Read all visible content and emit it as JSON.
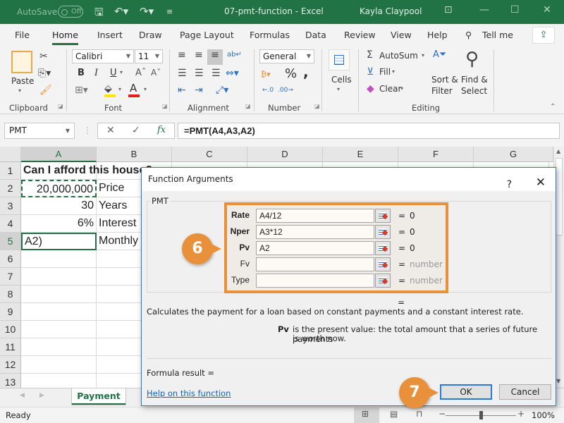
{
  "titlebar": {
    "autosave_label": "AutoSave",
    "autosave_state": "Off",
    "title": "07-pmt-function  -  Excel",
    "user": "Kayla Claypool"
  },
  "menu_tabs": [
    "File",
    "Home",
    "Insert",
    "Draw",
    "Page Layout",
    "Formulas",
    "Data",
    "Review",
    "View",
    "Help",
    "Tell me"
  ],
  "ribbon": {
    "clipboard": {
      "paste": "Paste",
      "label": "Clipboard"
    },
    "font": {
      "name": "Calibri",
      "size": "11",
      "label": "Font",
      "bold": "B",
      "italic": "I",
      "underline": "U",
      "fill_color": "#ffe600",
      "font_color": "#e0201b"
    },
    "alignment": {
      "label": "Alignment"
    },
    "number": {
      "format": "General",
      "label": "Number",
      "percent": "%",
      "comma": ","
    },
    "cells": {
      "label": "Cells"
    },
    "editing": {
      "autosum": "AutoSum",
      "fill": "Fill",
      "clear": "Clear",
      "sort_filter_1": "Sort &",
      "sort_filter_2": "Filter",
      "find_select_1": "Find &",
      "find_select_2": "Select",
      "label": "Editing"
    }
  },
  "formula_bar": {
    "name_box": "PMT",
    "formula": "=PMT(A4,A3,A2)"
  },
  "grid": {
    "columns": [
      "A",
      "B",
      "C",
      "D",
      "E",
      "F",
      "G"
    ],
    "rows": [
      "1",
      "2",
      "3",
      "4",
      "5",
      "6",
      "7",
      "8",
      "9",
      "10",
      "11",
      "12",
      "13"
    ],
    "cells": {
      "A1": "Can I afford this house?",
      "A2": "20,000,000",
      "B2": "Price",
      "A3": "30",
      "B3": "Years",
      "A4": "6%",
      "B4": "Interest",
      "A5": "A2)",
      "B5": "Monthly"
    }
  },
  "sheet_tabs": [
    "Payment"
  ],
  "status": {
    "ready": "Ready",
    "zoom": "100%",
    "zoom_level_percent": 100
  },
  "dialog": {
    "title": "Function Arguments",
    "help": "?",
    "function_name": "PMT",
    "args": [
      {
        "label": "Rate",
        "value": "A4/12",
        "result": "0",
        "bold": true
      },
      {
        "label": "Nper",
        "value": "A3*12",
        "result": "0",
        "bold": true
      },
      {
        "label": "Pv",
        "value": "A2",
        "result": "0",
        "bold": true
      },
      {
        "label": "Fv",
        "value": "",
        "result": "number",
        "bold": false
      },
      {
        "label": "Type",
        "value": "",
        "result": "number",
        "bold": false
      }
    ],
    "equals": "=",
    "description": "Calculates the payment for a loan based on constant payments and a constant interest rate.",
    "arg_help_name": "Pv",
    "arg_help_text_1": "is the present value: the total amount that a series of future payments",
    "arg_help_text_2": "is worth now.",
    "formula_result": "Formula result =",
    "help_link": "Help on this function",
    "ok": "OK",
    "cancel": "Cancel"
  },
  "callouts": {
    "step6": "6",
    "step7": "7",
    "accent": "#e8913a"
  }
}
